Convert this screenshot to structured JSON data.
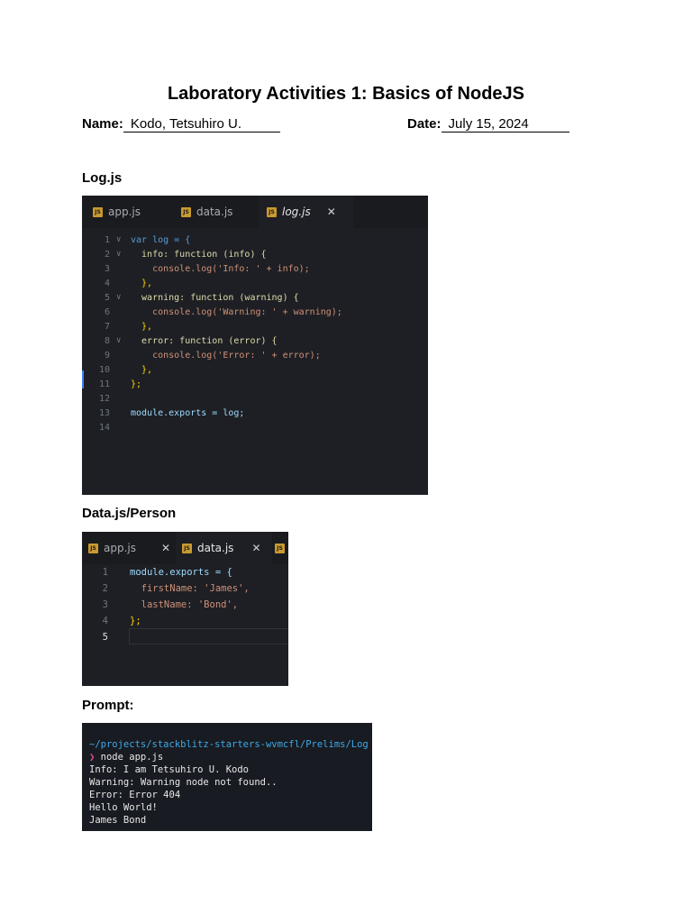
{
  "document": {
    "title": "Laboratory Activities 1: Basics of NodeJS",
    "name_label": "Name:",
    "name_value": "Kodo, Tetsuhiro U.",
    "date_label": "Date:",
    "date_value": "July 15, 2024"
  },
  "sections": {
    "log": "Log.js",
    "data": "Data.js/Person",
    "prompt": "Prompt:"
  },
  "editor1": {
    "tabs": [
      {
        "label": "app.js",
        "icon": "js-icon",
        "active": false
      },
      {
        "label": "data.js",
        "icon": "js-icon",
        "active": false
      },
      {
        "label": "log.js",
        "icon": "js-icon",
        "active": true,
        "close": "✕"
      }
    ],
    "line_numbers": [
      "1",
      "2",
      "3",
      "4",
      "5",
      "6",
      "7",
      "8",
      "9",
      "10",
      "11",
      "12",
      "13",
      "14"
    ],
    "lines": [
      "var log = {",
      "  info: function (info) {",
      "    console.log('Info: ' + info);",
      "  },",
      "  warning: function (warning) {",
      "    console.log('Warning: ' + warning);",
      "  },",
      "  error: function (error) {",
      "    console.log('Error: ' + error);",
      "  },",
      "};",
      "",
      "module.exports = log;",
      ""
    ]
  },
  "editor2": {
    "tabs": [
      {
        "label": "app.js",
        "icon": "js-icon",
        "active": false,
        "close": "✕"
      },
      {
        "label": "data.js",
        "icon": "js-icon",
        "active": true,
        "close": "✕"
      },
      {
        "label": "",
        "icon": "js-icon",
        "active": false
      }
    ],
    "line_numbers": [
      "1",
      "2",
      "3",
      "4",
      "5"
    ],
    "lines": [
      "module.exports = {",
      "  firstName: 'James',",
      "  lastName: 'Bond',",
      "};",
      ""
    ]
  },
  "terminal": {
    "path": "~/projects/stackblitz-starters-wvmcfl/Prelims/Log",
    "prompt_symbol": "❯",
    "command": "node app.js",
    "output": [
      "Info: I am Tetsuhiro U. Kodo",
      "Warning: Warning node not found..",
      "Error: Error 404",
      "Hello World!",
      "James Bond"
    ]
  },
  "colors": {
    "editor_bg": "#1e1f24",
    "keyword": "#569cd6",
    "string": "#ce9178",
    "property": "#dcdcaa",
    "terminal_path": "#3fa9e6",
    "terminal_prompt": "#e84a8a"
  }
}
